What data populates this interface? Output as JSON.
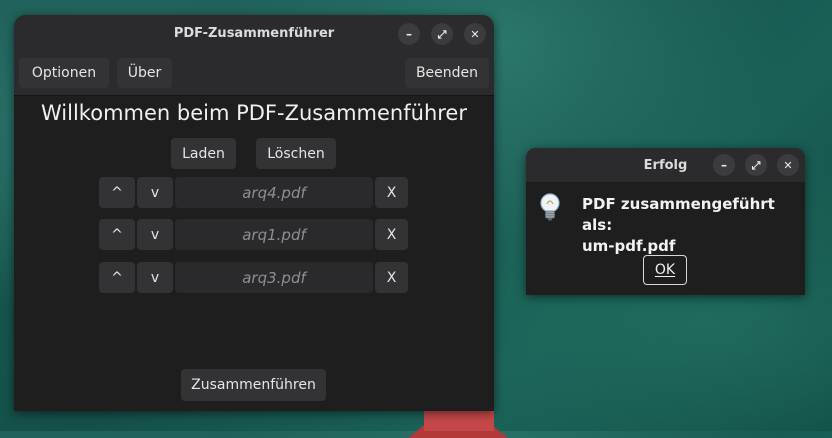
{
  "main_window": {
    "title": "PDF-Zusammenführer",
    "toolbar": {
      "options_label": "Optionen",
      "about_label": "Über",
      "quit_label": "Beenden"
    },
    "welcome_text": "Willkommen beim PDF-Zusammenführer",
    "load_label": "Laden",
    "delete_label": "Löschen",
    "up_label": "^",
    "down_label": "v",
    "remove_label": "X",
    "files": [
      "arq4.pdf",
      "arq1.pdf",
      "arq3.pdf"
    ],
    "merge_label": "Zusammenführen"
  },
  "window_controls": {
    "minimize": "–",
    "maximize": "⤢",
    "close": "✕"
  },
  "dialog": {
    "title": "Erfolg",
    "message_line1": "PDF zusammengeführt als:",
    "message_line2": "um-pdf.pdf",
    "ok_label": "OK",
    "icon": "lightbulb-icon"
  },
  "colors": {
    "window_bg": "#1f1e1f",
    "titlebar_bg": "#2b2a2c",
    "button_bg": "#333234",
    "desktop_teal": "#1c5a55"
  }
}
